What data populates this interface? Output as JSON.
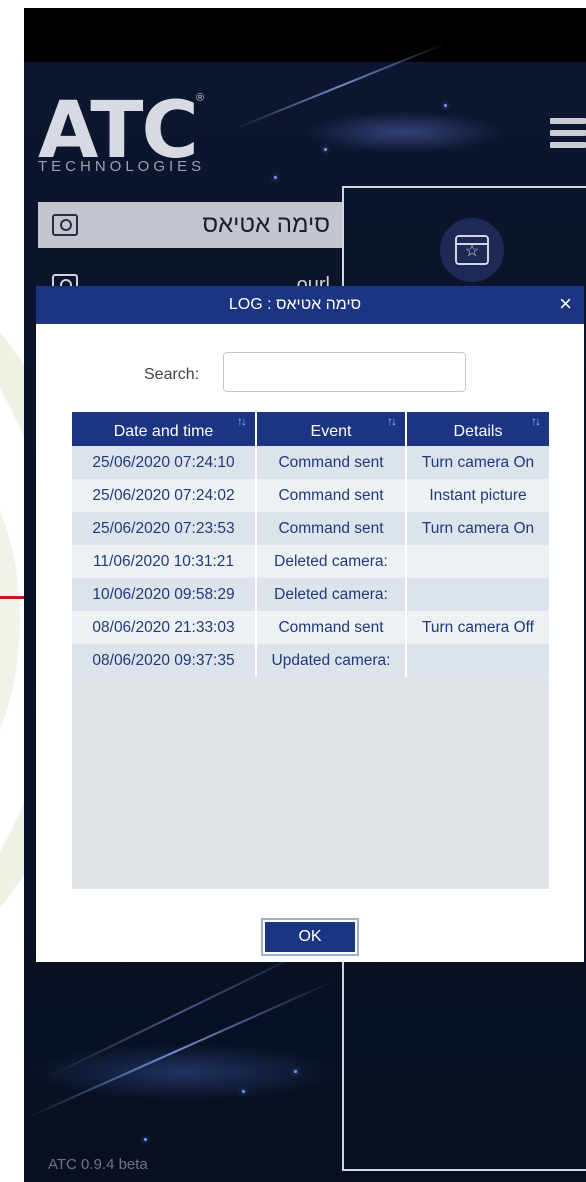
{
  "app": {
    "logo_text": "ATC",
    "logo_subtitle": "TECHNOLOGIES",
    "version": "ATC 0.9.4 beta",
    "menu_icon": "hamburger-menu-icon"
  },
  "sidebar": {
    "items": [
      {
        "label": "סימה אטיאס",
        "icon": "camera-icon",
        "active": true
      },
      {
        "label": "ourl",
        "icon": "camera-icon",
        "active": false
      }
    ]
  },
  "panel": {
    "icon": "calendar-star-icon"
  },
  "modal": {
    "title": "LOG : סימה אטיאס",
    "close": "×",
    "search_label": "Search:",
    "search_value": "",
    "columns": [
      "Date and time",
      "Event",
      "Details"
    ],
    "sort_glyph": "↑↓",
    "rows": [
      [
        "25/06/2020 07:24:10",
        "Command sent",
        "Turn camera On"
      ],
      [
        "25/06/2020 07:24:02",
        "Command sent",
        "Instant picture"
      ],
      [
        "25/06/2020 07:23:53",
        "Command sent",
        "Turn camera On"
      ],
      [
        "11/06/2020 10:31:21",
        "Deleted camera:",
        ""
      ],
      [
        "10/06/2020 09:58:29",
        "Deleted camera:",
        ""
      ],
      [
        "08/06/2020 21:33:03",
        "Command sent",
        "Turn camera Off"
      ],
      [
        "08/06/2020 09:37:35",
        "Updated camera:",
        ""
      ]
    ],
    "ok_label": "OK"
  },
  "colors": {
    "header_blue": "#1c3583",
    "cell_text": "#1e3a7a",
    "app_background": "#0a1124"
  }
}
